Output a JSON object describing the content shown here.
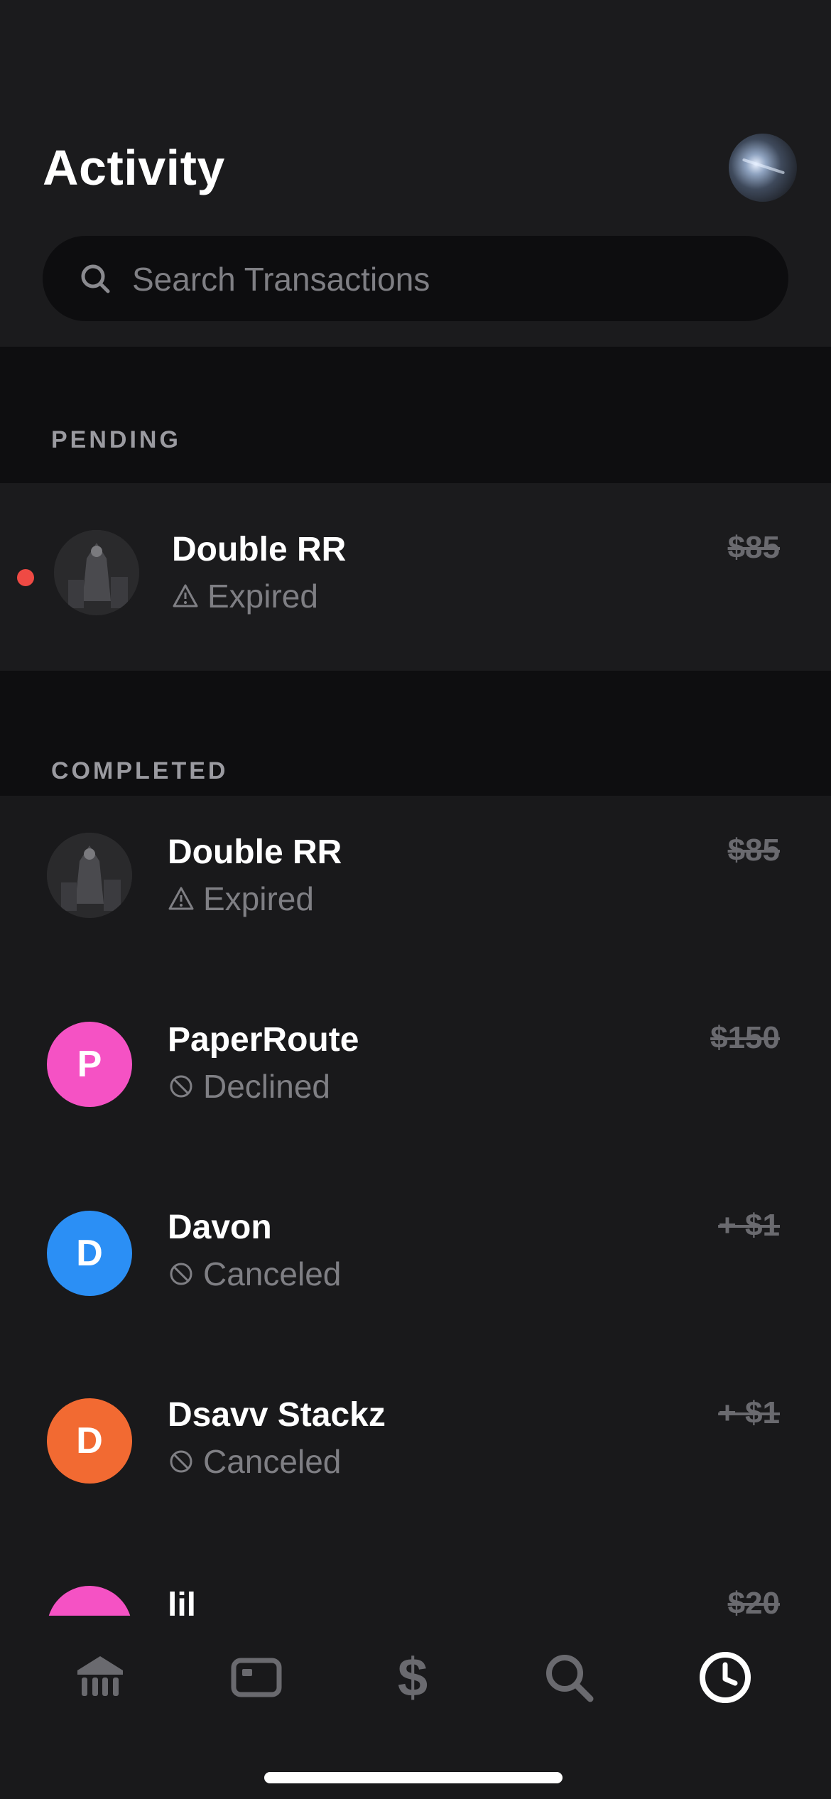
{
  "header": {
    "title": "Activity"
  },
  "search": {
    "placeholder": "Search Transactions"
  },
  "sections": {
    "pending": "PENDING",
    "completed": "COMPLETED"
  },
  "pending": [
    {
      "name": "Double RR",
      "status": "Expired",
      "status_icon": "warning-icon",
      "amount": "$85",
      "unread": true
    }
  ],
  "completed": [
    {
      "name": "Double RR",
      "status": "Expired",
      "status_icon": "warning-icon",
      "amount": "$85",
      "avatar": "photo"
    },
    {
      "name": "PaperRoute",
      "status": "Declined",
      "status_icon": "ban-icon",
      "amount": "$150",
      "initial": "P",
      "color": "#f552c4"
    },
    {
      "name": "Davon",
      "status": "Canceled",
      "status_icon": "ban-icon",
      "amount": "+ $1",
      "initial": "D",
      "color": "#2b8ff5"
    },
    {
      "name": "Dsavv Stackz",
      "status": "Canceled",
      "status_icon": "ban-icon",
      "amount": "+ $1",
      "initial": "D",
      "color": "#f26a32"
    },
    {
      "name": "lil",
      "amount": "$20",
      "color": "#f552c4"
    }
  ],
  "tabs": [
    {
      "icon": "bank-icon",
      "active": false
    },
    {
      "icon": "card-icon",
      "active": false
    },
    {
      "icon": "dollar-icon",
      "active": false
    },
    {
      "icon": "search-icon",
      "active": false
    },
    {
      "icon": "clock-icon",
      "active": true
    }
  ],
  "colors": {
    "background": "#19191b",
    "muted": "#7f7f84",
    "unread_dot": "#ef4a44",
    "active_tab": "#ffffff",
    "inactive_tab": "#6a6a6f"
  }
}
